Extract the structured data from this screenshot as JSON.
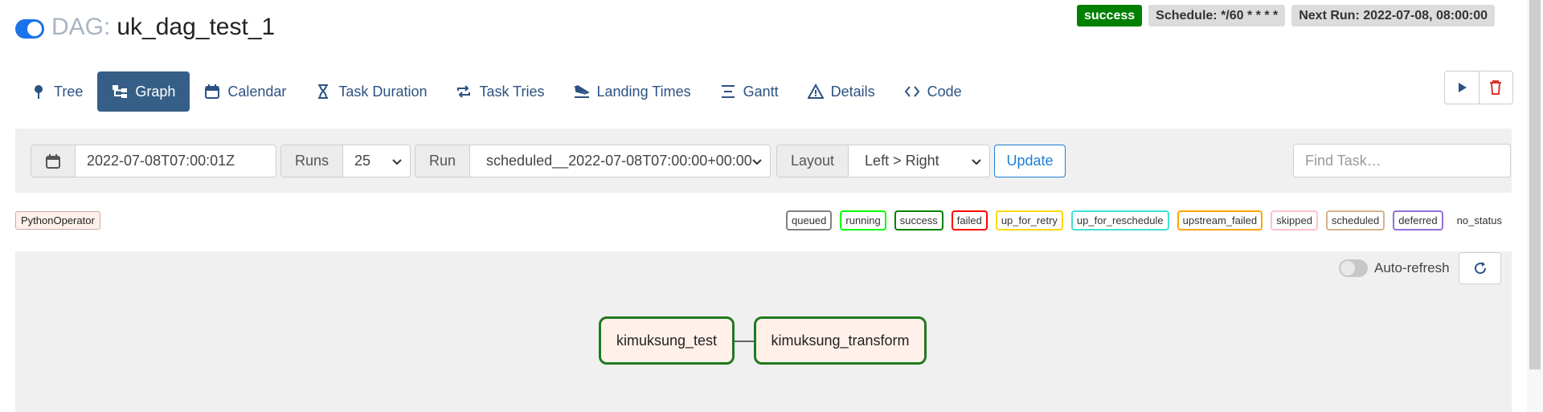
{
  "header": {
    "dag_prefix": "DAG:",
    "dag_id": "uk_dag_test_1",
    "status_badge": "success",
    "schedule": "Schedule: */60 * * * *",
    "next_run": "Next Run: 2022-07-08, 08:00:00"
  },
  "nav": {
    "tabs": [
      {
        "label": "Tree",
        "icon": "leaf-icon"
      },
      {
        "label": "Graph",
        "icon": "graph-icon",
        "active": true
      },
      {
        "label": "Calendar",
        "icon": "calendar-icon"
      },
      {
        "label": "Task Duration",
        "icon": "hourglass-icon"
      },
      {
        "label": "Task Tries",
        "icon": "repeat-icon"
      },
      {
        "label": "Landing Times",
        "icon": "plane-landing-icon"
      },
      {
        "label": "Gantt",
        "icon": "gantt-icon"
      },
      {
        "label": "Details",
        "icon": "warning-triangle-icon"
      },
      {
        "label": "Code",
        "icon": "code-icon"
      }
    ]
  },
  "filters": {
    "date_value": "2022-07-08T07:00:01Z",
    "runs_label": "Runs",
    "runs_value": "25",
    "run_label": "Run",
    "run_value": "scheduled__2022-07-08T07:00:00+00:00",
    "layout_label": "Layout",
    "layout_value": "Left > Right",
    "update_label": "Update",
    "find_task_placeholder": "Find Task…"
  },
  "legend": {
    "operator": "PythonOperator",
    "states": [
      {
        "label": "queued",
        "color": "#808080"
      },
      {
        "label": "running",
        "color": "#00ff00"
      },
      {
        "label": "success",
        "color": "#008000"
      },
      {
        "label": "failed",
        "color": "#ff0000"
      },
      {
        "label": "up_for_retry",
        "color": "#ffd700"
      },
      {
        "label": "up_for_reschedule",
        "color": "#40e0d0"
      },
      {
        "label": "upstream_failed",
        "color": "#ffa500"
      },
      {
        "label": "skipped",
        "color": "#ffc0cb"
      },
      {
        "label": "scheduled",
        "color": "#d2b48c"
      },
      {
        "label": "deferred",
        "color": "#9370db"
      },
      {
        "label": "no_status",
        "color": ""
      }
    ]
  },
  "graph": {
    "auto_refresh_label": "Auto-refresh",
    "nodes": [
      {
        "label": "kimuksung_test"
      },
      {
        "label": "kimuksung_transform"
      }
    ],
    "node_border_color": "#1f7a1f",
    "node_fill_color": "#fff0ea"
  }
}
